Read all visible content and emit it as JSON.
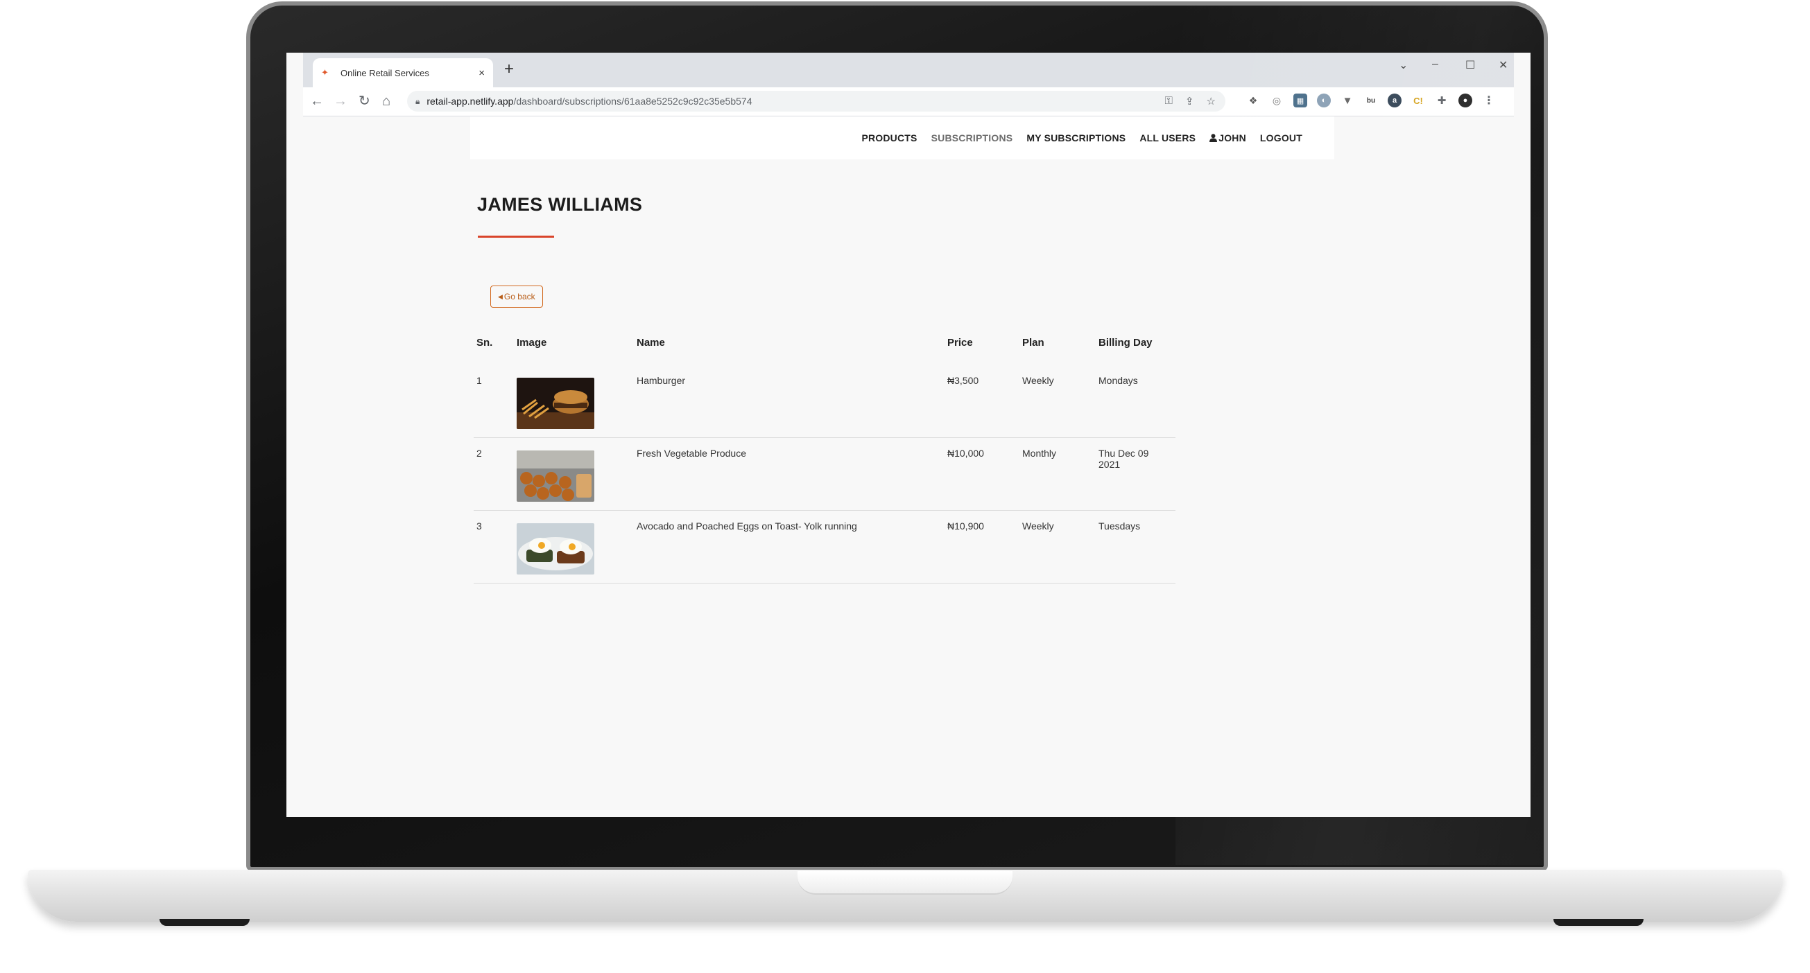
{
  "browser": {
    "tab_title": "Online Retail Services",
    "tab_close": "×",
    "new_tab": "+",
    "url_host": "retail-app.netlify.app",
    "url_path": "/dashboard/subscriptions/61aa8e5252c9c92c35e5b574",
    "window_controls": {
      "minimize": "–",
      "maximize": "☐",
      "close": "✕",
      "tab_search": "⌄"
    }
  },
  "navbar": {
    "links": [
      {
        "label": "PRODUCTS",
        "active": false
      },
      {
        "label": "SUBSCRIPTIONS",
        "active": true
      },
      {
        "label": "MY SUBSCRIPTIONS",
        "active": false
      },
      {
        "label": "ALL USERS",
        "active": false
      },
      {
        "label": "JOHN",
        "active": false,
        "icon": "user-icon"
      },
      {
        "label": "LOGOUT",
        "active": false
      }
    ]
  },
  "page": {
    "title": "JAMES WILLIAMS",
    "go_back_label": "Go back",
    "accent_color": "#d9452b"
  },
  "table": {
    "headers": {
      "sn": "Sn.",
      "image": "Image",
      "name": "Name",
      "price": "Price",
      "plan": "Plan",
      "billing": "Billing Day"
    },
    "rows": [
      {
        "sn": "1",
        "name": "Hamburger",
        "price": "₦3,500",
        "plan": "Weekly",
        "billing": "Mondays",
        "image": "hamburger-image"
      },
      {
        "sn": "2",
        "name": "Fresh Vegetable Produce",
        "price": "₦10,000",
        "plan": "Monthly",
        "billing": "Thu Dec 09 2021",
        "image": "bread-rolls-image"
      },
      {
        "sn": "3",
        "name": "Avocado and Poached Eggs on Toast- Yolk running",
        "price": "₦10,900",
        "plan": "Weekly",
        "billing": "Tuesdays",
        "image": "poached-eggs-image"
      }
    ]
  }
}
